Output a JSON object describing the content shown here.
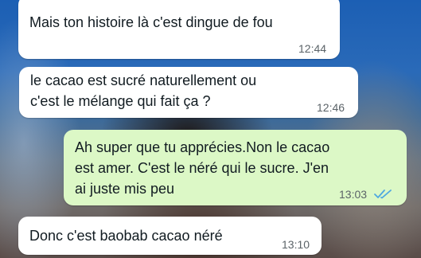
{
  "chat": {
    "messages": [
      {
        "direction": "incoming",
        "text": "Mais ton histoire là c'est dingue de fou",
        "time": "12:44"
      },
      {
        "direction": "incoming",
        "text": "le cacao est sucré naturellement ou\nc'est le mélange qui fait ça ?",
        "time": "12:46"
      },
      {
        "direction": "outgoing",
        "text": "Ah super que tu apprécies.Non le cacao\nest amer. C'est le néré qui le sucre. J'en\nai juste mis peu",
        "time": "13:03",
        "status_icon": "double-check-read-icon",
        "status_color": "#4fa8e0"
      },
      {
        "direction": "incoming",
        "text": "Donc c'est baobab cacao néré",
        "time": "13:10"
      }
    ]
  },
  "colors": {
    "incoming_bubble": "#ffffff",
    "outgoing_bubble": "#dcf8c6",
    "read_ticks": "#4fa8e0"
  }
}
